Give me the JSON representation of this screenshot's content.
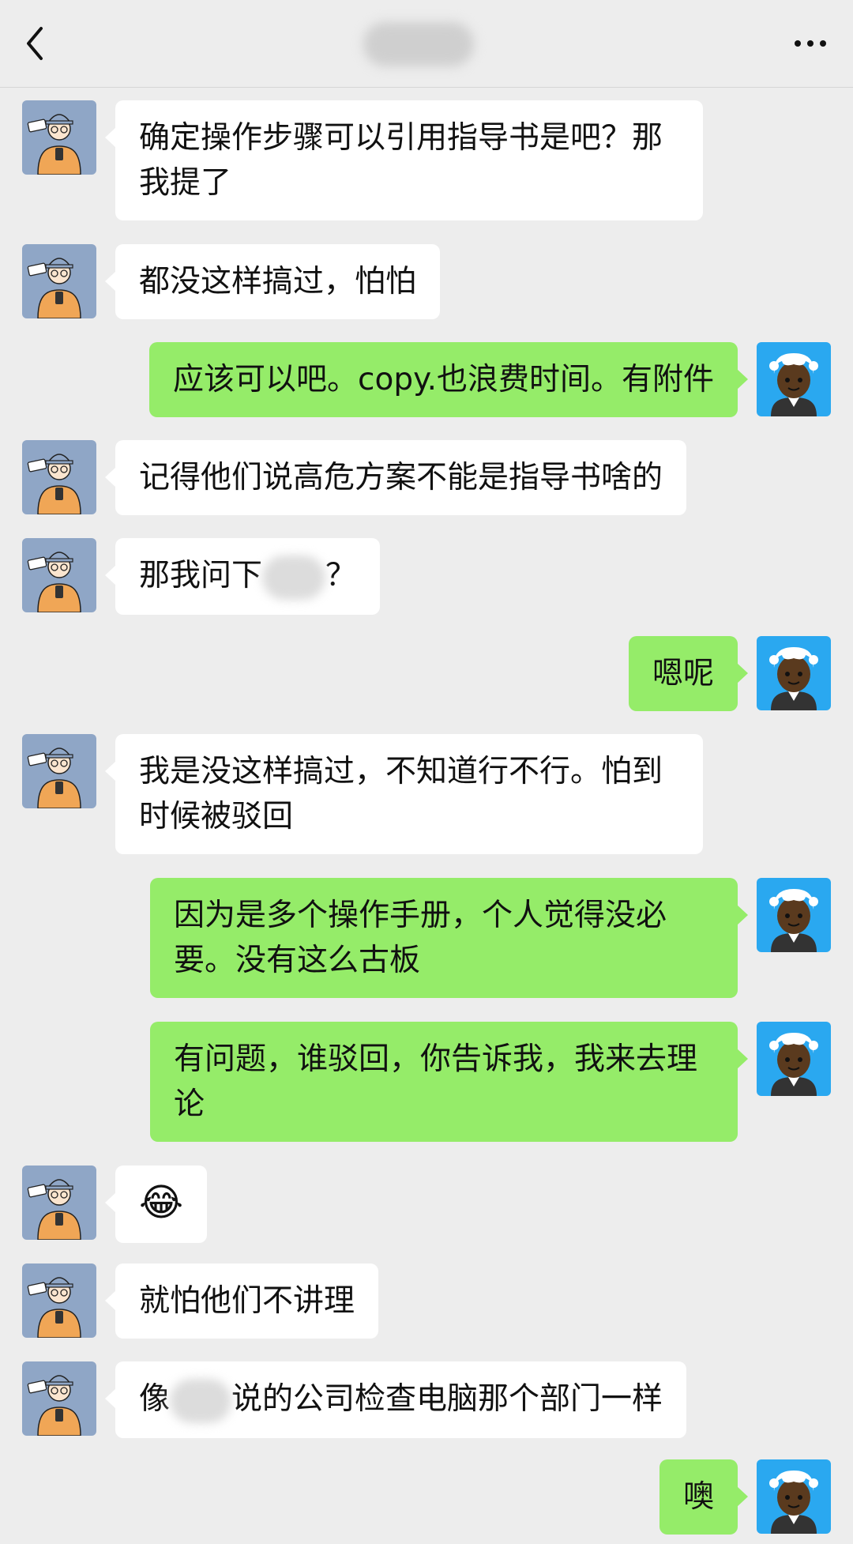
{
  "header": {
    "title": "",
    "back_icon": "chevron-left-icon",
    "more_icon": "more-horizontal-icon"
  },
  "colors": {
    "background": "#ededed",
    "incoming_bubble": "#ffffff",
    "outgoing_bubble": "#95ec69",
    "self_avatar_bg": "#2aa8f0"
  },
  "messages": [
    {
      "side": "in",
      "text": "确定操作步骤可以引用指导书是吧？那我提了"
    },
    {
      "side": "in",
      "text": "都没这样搞过，怕怕"
    },
    {
      "side": "out",
      "text": "应该可以吧。copy.也浪费时间。有附件"
    },
    {
      "side": "in",
      "text": "记得他们说高危方案不能是指导书啥的"
    },
    {
      "side": "in",
      "text_before": "那我问下",
      "text_after": "？"
    },
    {
      "side": "out",
      "text": "嗯呢"
    },
    {
      "side": "in",
      "text": "我是没这样搞过，不知道行不行。怕到时候被驳回"
    },
    {
      "side": "out",
      "text": "因为是多个操作手册，个人觉得没必要。没有这么古板"
    },
    {
      "side": "out",
      "text": "有问题，谁驳回，你告诉我，我来去理论"
    },
    {
      "side": "in",
      "emoji": "😂"
    },
    {
      "side": "in",
      "text": "就怕他们不讲理"
    },
    {
      "side": "in",
      "text_before": "像",
      "text_after": "说的公司检查电脑那个部门一样"
    },
    {
      "side": "out",
      "text": "噢"
    }
  ]
}
